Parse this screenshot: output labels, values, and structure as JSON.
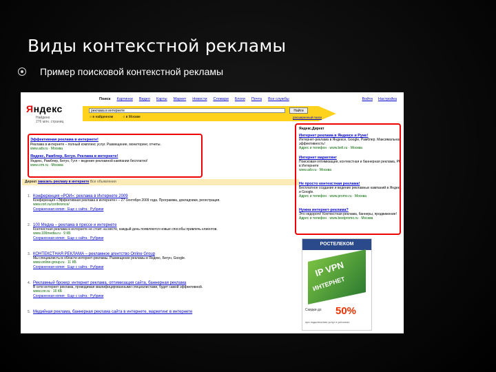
{
  "slide": {
    "title": "Виды контекстной рекламы",
    "bullet": "Пример поисковой контекстной рекламы"
  },
  "colors": {
    "highlight": "#ee0000",
    "link": "#0000cc",
    "url": "#006600",
    "search_bar": "#ffd21e"
  },
  "yandex": {
    "logo_first": "Я",
    "logo_rest": "ндекс",
    "nav": [
      "Поиск",
      "Картинки",
      "Видео",
      "Карты",
      "Маркет",
      "Новости",
      "Словари",
      "Блоги",
      "Почта",
      "Все службы"
    ],
    "top_links": [
      "Войти",
      "Настройка"
    ],
    "region": [
      "Найдено",
      "276 млн. страниц"
    ],
    "search_value": "реклама в интернете",
    "search_button": "Найти",
    "radios": [
      "в найденном",
      "в Москве"
    ],
    "advanced": "расширенный поиск"
  },
  "top_ads": [
    {
      "title": "Эффективная реклама в интернете!",
      "desc": "Реклама в интернете – полный комплекс услуг. Размещение, мониторинг, отчеты.",
      "url": "www.adv.ru · Москва"
    },
    {
      "title": "Яндекс, Рамблер, Бегун. Реклама в интернете!",
      "desc": "Яндекс, Рамблер, Бегун, Гугл – ведение рекламной кампании бесплатно!",
      "url": "www.crm.ru · Москва"
    }
  ],
  "direct_bar": {
    "label": "Директ",
    "text": "заказать рекламу в интернете",
    "tail": "Все объявления"
  },
  "results": [
    {
      "num": "1.",
      "title": "Конференция «РОИ»: реклама в Интернете 2009",
      "desc": "Конференция «Эффективная реклама в интернете» – 27 сентября 2009 года. Программа, докладчики, регистрация.",
      "url": "www.rort.ru/conference/",
      "meta": "Сохраненная копия · Еще с сайта · Рубрики"
    },
    {
      "num": "2.",
      "title": "100 Медиа – реклама в прессе и интернете",
      "desc": "Контекстная реклама в интернете не стоит на месте, каждый день появляются новые способы привлечь клиентов.",
      "url": "www.100media.ru · 9 КБ",
      "meta": "Сохраненная копия · Еще с сайта · Рубрики"
    },
    {
      "num": "3.",
      "title": "КОНТЕКСТНАЯ РЕКЛАМА – рекламное агентство Online Group",
      "desc": "Мы специалисты в области интернет-рекламы. Размещение рекламы в Яндекс, Бегун, Google.",
      "url": "www.online-group.ru · 11 КБ",
      "meta": "Сохраненная копия · Еще с сайта · Рубрики"
    },
    {
      "num": "4.",
      "title": "Рекламный брокер: интернет реклама, оптимизация сайта, баннерная реклама",
      "desc": "В сети интернет реклама, проводимая квалифицированными специалистами, будет самой эффективной.",
      "url": "www.cnr.ru · 16 КБ",
      "meta": "Сохраненная копия · Еще с сайта · Рубрики"
    },
    {
      "num": "5.",
      "title": "Медийная реклама, баннерная реклама сайта в интернете, маркетинг в интернете",
      "desc": "",
      "url": "",
      "meta": ""
    }
  ],
  "right_ads": {
    "header": "Яндекс.Директ",
    "items": [
      {
        "title": "Интернет реклама в Яндексе и Руне!",
        "desc": "Интернет-реклама в Яндексе, Google, Рамблер. Максимальная эффективность!",
        "url": "Адрес и телефон · www.belt.ru · Москва"
      },
      {
        "title": "Интернет маркетинг",
        "desc": "Поисковая оптимизация, контекстная и баннерная реклама, PR в Интернете",
        "url": "www.adv.ru · Москва"
      },
      {
        "title": "Не просто контекстная реклама!",
        "desc": "Бесплатное создание и ведение рекламных кампаний в Яндекс и Google.",
        "url": "Адрес и телефон · www.promo.ru · Москва"
      },
      {
        "title": "Нужна интернет-реклама?",
        "desc": "Это недорого! Контекстная реклама, баннеры, продвижение!",
        "url": "Адрес и телефон · www.bestpromo.ru · Москва"
      }
    ]
  },
  "banner": {
    "brand": "РОСТЕЛЕКОМ",
    "line1": "IP VPN",
    "line2": "ИНТЕРНЕТ",
    "discount_label": "Скидки до",
    "discount": "50%",
    "fine": "при подключении услуг в регионах"
  }
}
